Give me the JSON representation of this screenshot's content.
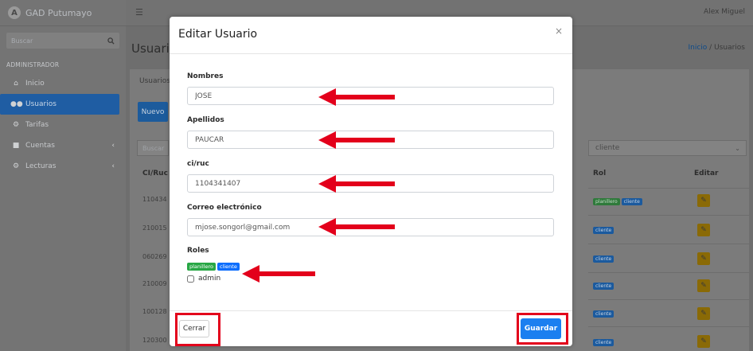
{
  "sidebar": {
    "brand": "GAD Putumayo",
    "brand_logo": "A",
    "search_placeholder": "Buscar",
    "section": "ADMINISTRADOR",
    "items": [
      {
        "label": "Inicio",
        "icon": "home-icon"
      },
      {
        "label": "Usuarios",
        "icon": "users-icon",
        "active": true
      },
      {
        "label": "Tarifas",
        "icon": "cogs-icon"
      },
      {
        "label": "Cuentas",
        "icon": "book-icon",
        "has_submenu": true
      },
      {
        "label": "Lecturas",
        "icon": "cogs-icon",
        "has_submenu": true
      }
    ]
  },
  "topbar": {
    "user": "Alex Miguel",
    "menu_icon": "hamburger-icon"
  },
  "page": {
    "title": "Usuari",
    "breadcrumb_home": "Inicio",
    "breadcrumb_sep": "/",
    "breadcrumb_current": "Usuarios",
    "card_tab": "Usuarios",
    "new_button": "Nuevo",
    "table_search_placeholder": "Buscar",
    "role_filter": "cliente",
    "columns": {
      "id": "CI/Ruc",
      "rol": "Rol",
      "edit": "Editar"
    },
    "rows": [
      {
        "id": "110434",
        "roles": [
          "planillero",
          "cliente"
        ]
      },
      {
        "id": "210015",
        "roles": [
          "cliente"
        ]
      },
      {
        "id": "060269",
        "roles": [
          "cliente"
        ]
      },
      {
        "id": "210009",
        "roles": [
          "cliente"
        ]
      },
      {
        "id": "100128",
        "roles": [
          "cliente"
        ]
      },
      {
        "id": "120300",
        "roles": [
          "cliente"
        ]
      }
    ]
  },
  "modal": {
    "title": "Editar Usuario",
    "close": "×",
    "fields": [
      {
        "label": "Nombres",
        "value": "JOSE"
      },
      {
        "label": "Apellidos",
        "value": "PAUCAR"
      },
      {
        "label": "ci/ruc",
        "value": "1104341407"
      },
      {
        "label": "Correo electrónico",
        "value": "mjose.songorl@gmail.com"
      }
    ],
    "roles_label": "Roles",
    "role_badges": [
      "planillero",
      "cliente"
    ],
    "admin_checkbox": "admin",
    "cancel_button": "Cerrar",
    "save_button": "Guardar"
  },
  "colors": {
    "annotation_red": "#e3001b",
    "primary": "#1b7ff0",
    "success": "#28a745"
  }
}
